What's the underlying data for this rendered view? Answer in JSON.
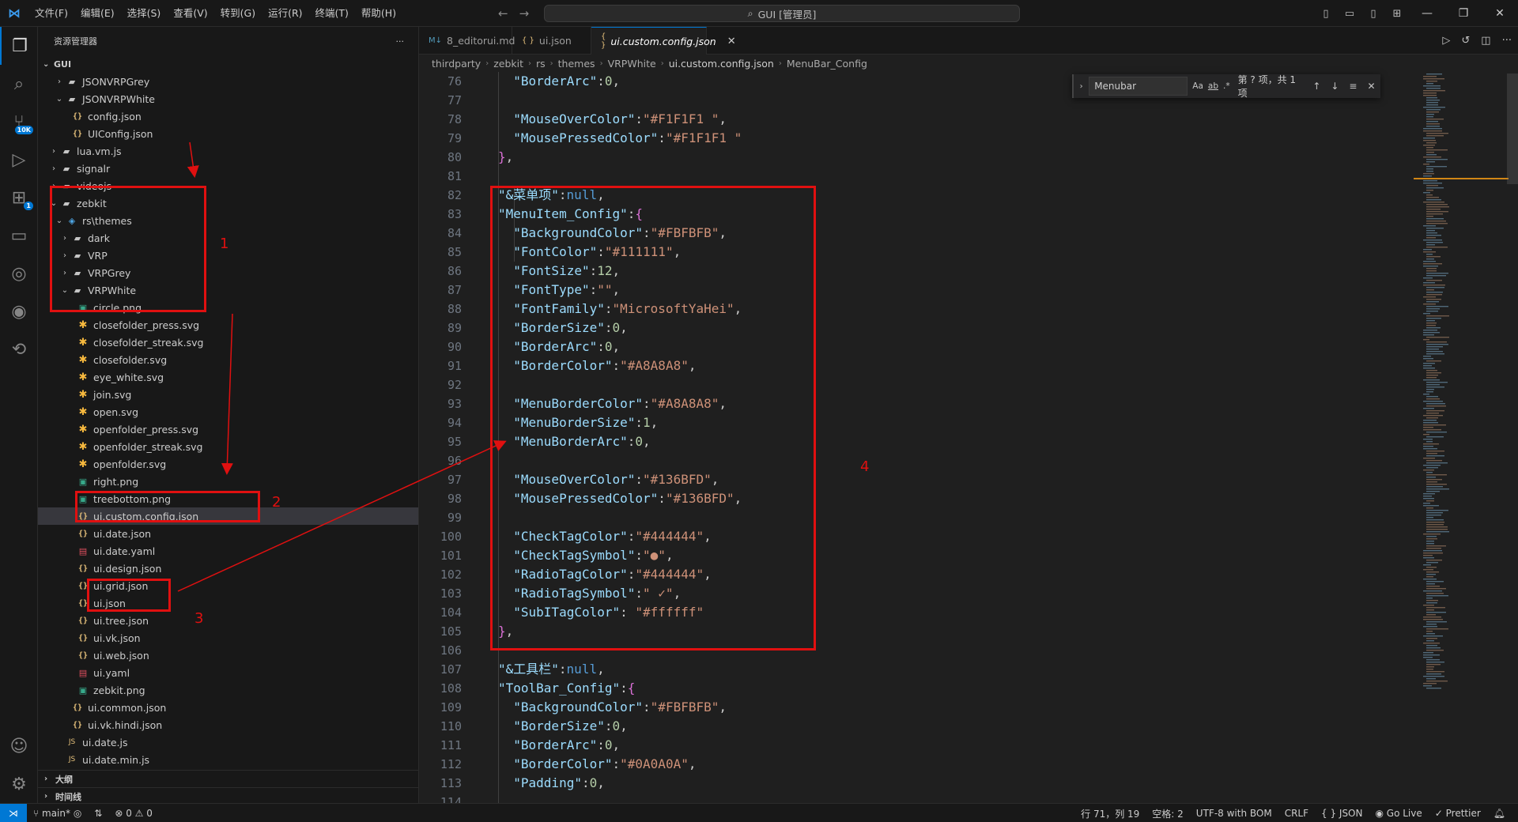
{
  "titlebar": {
    "menu": [
      "文件(F)",
      "编辑(E)",
      "选择(S)",
      "查看(V)",
      "转到(G)",
      "运行(R)",
      "终端(T)",
      "帮助(H)"
    ],
    "command_center": "GUI [管理员]"
  },
  "activity": {
    "badge_source_control": "10K",
    "badge_extensions": "1"
  },
  "sidebar": {
    "title": "资源管理器",
    "more": "···",
    "root": "GUI",
    "tree": [
      {
        "label": "JSONVRPGrey",
        "type": "folder",
        "indent": 2,
        "chev": "›"
      },
      {
        "label": "JSONVRPWhite",
        "type": "folder",
        "indent": 2,
        "chev": "⌄"
      },
      {
        "label": "config.json",
        "type": "json",
        "indent": 3
      },
      {
        "label": "UIConfig.json",
        "type": "json",
        "indent": 3
      },
      {
        "label": "lua.vm.js",
        "type": "folder",
        "indent": 1,
        "chev": "›"
      },
      {
        "label": "signalr",
        "type": "folder",
        "indent": 1,
        "chev": "›"
      },
      {
        "label": "videojs",
        "type": "folder",
        "indent": 1,
        "chev": "›"
      },
      {
        "label": "zebkit",
        "type": "folder",
        "indent": 1,
        "chev": "⌄"
      },
      {
        "label": "rs\\themes",
        "type": "special",
        "indent": 2,
        "chev": "⌄"
      },
      {
        "label": "dark",
        "type": "folder",
        "indent": 3,
        "chev": "›"
      },
      {
        "label": "VRP",
        "type": "folder",
        "indent": 3,
        "chev": "›"
      },
      {
        "label": "VRPGrey",
        "type": "folder",
        "indent": 3,
        "chev": "›"
      },
      {
        "label": "VRPWhite",
        "type": "folder",
        "indent": 3,
        "chev": "⌄"
      },
      {
        "label": "circle.png",
        "type": "png",
        "indent": 4
      },
      {
        "label": "closefolder_press.svg",
        "type": "svg",
        "indent": 4
      },
      {
        "label": "closefolder_streak.svg",
        "type": "svg",
        "indent": 4
      },
      {
        "label": "closefolder.svg",
        "type": "svg",
        "indent": 4
      },
      {
        "label": "eye_white.svg",
        "type": "svg",
        "indent": 4
      },
      {
        "label": "join.svg",
        "type": "svg",
        "indent": 4
      },
      {
        "label": "open.svg",
        "type": "svg",
        "indent": 4
      },
      {
        "label": "openfolder_press.svg",
        "type": "svg",
        "indent": 4
      },
      {
        "label": "openfolder_streak.svg",
        "type": "svg",
        "indent": 4
      },
      {
        "label": "openfolder.svg",
        "type": "svg",
        "indent": 4
      },
      {
        "label": "right.png",
        "type": "png",
        "indent": 4
      },
      {
        "label": "treebottom.png",
        "type": "png",
        "indent": 4
      },
      {
        "label": "ui.custom.config.json",
        "type": "json",
        "indent": 4,
        "selected": true
      },
      {
        "label": "ui.date.json",
        "type": "json",
        "indent": 4
      },
      {
        "label": "ui.date.yaml",
        "type": "yaml",
        "indent": 4
      },
      {
        "label": "ui.design.json",
        "type": "json",
        "indent": 4
      },
      {
        "label": "ui.grid.json",
        "type": "json",
        "indent": 4
      },
      {
        "label": "ui.json",
        "type": "json",
        "indent": 4
      },
      {
        "label": "ui.tree.json",
        "type": "json",
        "indent": 4
      },
      {
        "label": "ui.vk.json",
        "type": "json",
        "indent": 4
      },
      {
        "label": "ui.web.json",
        "type": "json",
        "indent": 4
      },
      {
        "label": "ui.yaml",
        "type": "yaml",
        "indent": 4
      },
      {
        "label": "zebkit.png",
        "type": "png",
        "indent": 4
      },
      {
        "label": "ui.common.json",
        "type": "json",
        "indent": 3
      },
      {
        "label": "ui.vk.hindi.json",
        "type": "json",
        "indent": 3
      },
      {
        "label": "ui.date.js",
        "type": "js",
        "indent": 2
      },
      {
        "label": "ui.date.min.js",
        "type": "js",
        "indent": 2
      }
    ],
    "outline": "大纲",
    "timeline": "时间线"
  },
  "tabs": [
    {
      "label": "8_editorui.md",
      "icon": "M↓",
      "active": false
    },
    {
      "label": "ui.json",
      "icon": "{ }",
      "active": false
    },
    {
      "label": "ui.custom.config.json",
      "icon": "{ }",
      "active": true
    }
  ],
  "breadcrumb": [
    "thirdparty",
    "zebkit",
    "rs",
    "themes",
    "VRPWhite",
    "ui.custom.config.json",
    "MenuBar_Config"
  ],
  "find": {
    "query": "Menubar",
    "opt_case": "Aa",
    "opt_word": "ab",
    "opt_regex": ".*",
    "count": "第 ? 项，共 1 项"
  },
  "editor": {
    "lines": [
      {
        "n": "76",
        "t": "  \"BorderArc\":0,"
      },
      {
        "n": "77",
        "t": ""
      },
      {
        "n": "78",
        "t": "  \"MouseOverColor\":\"#F1F1F1 \","
      },
      {
        "n": "79",
        "t": "  \"MousePressedColor\":\"#F1F1F1 \""
      },
      {
        "n": "80",
        "t": "},"
      },
      {
        "n": "81",
        "t": ""
      },
      {
        "n": "82",
        "t": "\"&菜单项\":null,"
      },
      {
        "n": "83",
        "t": "\"MenuItem_Config\":{"
      },
      {
        "n": "84",
        "t": "  \"BackgroundColor\":\"#FBFBFB\","
      },
      {
        "n": "85",
        "t": "  \"FontColor\":\"#111111\","
      },
      {
        "n": "86",
        "t": "  \"FontSize\":12,"
      },
      {
        "n": "87",
        "t": "  \"FontType\":\"\","
      },
      {
        "n": "88",
        "t": "  \"FontFamily\":\"MicrosoftYaHei\","
      },
      {
        "n": "89",
        "t": "  \"BorderSize\":0,"
      },
      {
        "n": "90",
        "t": "  \"BorderArc\":0,"
      },
      {
        "n": "91",
        "t": "  \"BorderColor\":\"#A8A8A8\","
      },
      {
        "n": "92",
        "t": ""
      },
      {
        "n": "93",
        "t": "  \"MenuBorderColor\":\"#A8A8A8\","
      },
      {
        "n": "94",
        "t": "  \"MenuBorderSize\":1,"
      },
      {
        "n": "95",
        "t": "  \"MenuBorderArc\":0,"
      },
      {
        "n": "96",
        "t": ""
      },
      {
        "n": "97",
        "t": "  \"MouseOverColor\":\"#136BFD\","
      },
      {
        "n": "98",
        "t": "  \"MousePressedColor\":\"#136BFD\","
      },
      {
        "n": "99",
        "t": ""
      },
      {
        "n": "100",
        "t": "  \"CheckTagColor\":\"#444444\","
      },
      {
        "n": "101",
        "t": "  \"CheckTagSymbol\":\"●\","
      },
      {
        "n": "102",
        "t": "  \"RadioTagColor\":\"#444444\","
      },
      {
        "n": "103",
        "t": "  \"RadioTagSymbol\":\" ✓\","
      },
      {
        "n": "104",
        "t": "  \"SubITagColor\": \"#ffffff\""
      },
      {
        "n": "105",
        "t": "},"
      },
      {
        "n": "106",
        "t": ""
      },
      {
        "n": "107",
        "t": "\"&工具栏\":null,"
      },
      {
        "n": "108",
        "t": "\"ToolBar_Config\":{"
      },
      {
        "n": "109",
        "t": "  \"BackgroundColor\":\"#FBFBFB\","
      },
      {
        "n": "110",
        "t": "  \"BorderSize\":0,"
      },
      {
        "n": "111",
        "t": "  \"BorderArc\":0,"
      },
      {
        "n": "112",
        "t": "  \"BorderColor\":\"#0A0A0A\","
      },
      {
        "n": "113",
        "t": "  \"Padding\":0,"
      },
      {
        "n": "114",
        "t": ""
      }
    ]
  },
  "annotations": {
    "label_1": "1",
    "label_2": "2",
    "label_3": "3",
    "label_4": "4",
    "color": "#e01010"
  },
  "statusbar": {
    "branch": "main*",
    "problems": "⊗ 0 ⚠ 0",
    "position": "行 71，列 19",
    "spaces": "空格: 2",
    "encoding": "UTF-8 with BOM",
    "eol": "CRLF",
    "language": "{ } JSON",
    "golive": "Go Live",
    "prettier": "✓ Prettier"
  },
  "colors": {
    "accent": "#0078d4",
    "key": "#9cdcfe",
    "string": "#ce9178",
    "number": "#b5cea8",
    "keyword": "#569cd6"
  }
}
